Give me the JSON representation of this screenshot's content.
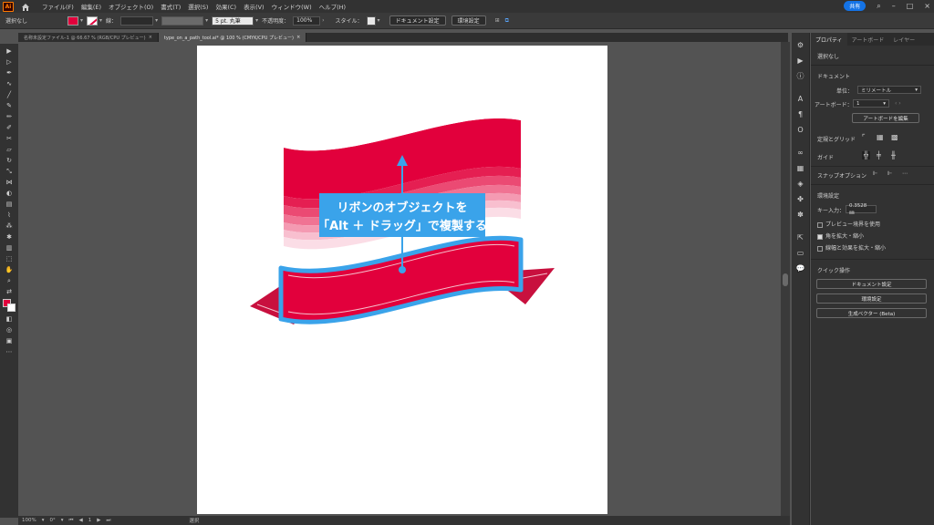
{
  "app": {
    "logo": "Ai"
  },
  "menus": [
    "ファイル(F)",
    "編集(E)",
    "オブジェクト(O)",
    "書式(T)",
    "選択(S)",
    "効果(C)",
    "表示(V)",
    "ウィンドウ(W)",
    "ヘルプ(H)"
  ],
  "topright": {
    "share": "共有",
    "minimize": "–",
    "maximize": "□",
    "close": "×"
  },
  "control": {
    "selection": "選択なし",
    "stroke_label": "線：",
    "stroke_weight": "",
    "brush": "5 pt. 丸筆",
    "opacity_label": "不透明度：",
    "opacity": "100%",
    "style_label": "スタイル：",
    "doc_settings": "ドキュメント設定",
    "prefs": "環境設定",
    "colors": {
      "fill": "#e2003c"
    }
  },
  "tabs": [
    {
      "label": "名称未設定ファイル-1 @ 66.67 % (RGB/CPU プレビュー)",
      "active": false
    },
    {
      "label": "type_on_a_path_tool.ai* @ 100 % (CMYK/CPU プレビュー)",
      "active": true
    }
  ],
  "annotation": {
    "line1": "リボンのオブジェクトを",
    "line2": "「Alt ＋ ドラッグ」で複製する",
    "bg": "#3aa3ea"
  },
  "artwork": {
    "ribbon_color": "#e2003c",
    "outline_color": "#3aa3ea"
  },
  "status": {
    "zoom": "100%",
    "rotate": "0°",
    "artboard": "1",
    "tool": "選択"
  },
  "panel": {
    "tabs": [
      "プロパティ",
      "アートボード",
      "レイヤー"
    ],
    "no_selection": "選択なし",
    "document": "ドキュメント",
    "unit_label": "単位：",
    "unit": "ミリメートル",
    "artboard_label": "アートボード：",
    "artboard": "1",
    "edit_artboard": "アートボードを編集",
    "rulers_grid": "定規とグリッド",
    "guides": "ガイド",
    "snap": "スナップオプション",
    "prefs_title": "環境設定",
    "key_input_label": "キー入力：",
    "key_input": "0.3528 ㎜",
    "preview_bounds": "プレビュー境界を使用",
    "scale_corners": "角を拡大・縮小",
    "scale_strokes": "線幅と効果を拡大・縮小",
    "quick_actions": "クイック操作",
    "btn_doc_settings": "ドキュメント設定",
    "btn_prefs": "環境設定",
    "btn_vector": "生成ベクター (Beta)"
  }
}
